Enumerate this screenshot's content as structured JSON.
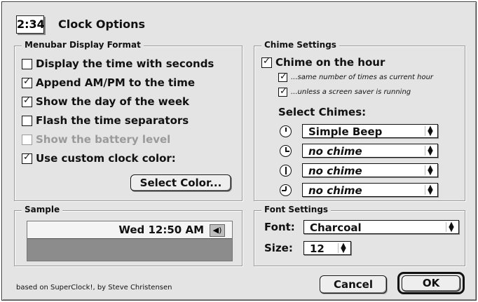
{
  "window": {
    "time_badge": "2:34",
    "title": "Clock Options"
  },
  "menubar_group": {
    "title": "Menubar Display Format",
    "options": [
      {
        "label": "Display the time with seconds",
        "checked": false,
        "enabled": true
      },
      {
        "label": "Append AM/PM to the time",
        "checked": true,
        "enabled": true
      },
      {
        "label": "Show the day of the week",
        "checked": true,
        "enabled": true
      },
      {
        "label": "Flash the time separators",
        "checked": false,
        "enabled": true
      },
      {
        "label": "Show the battery level",
        "checked": false,
        "enabled": false
      },
      {
        "label": "Use custom clock color:",
        "checked": true,
        "enabled": true
      }
    ],
    "select_color_button": "Select Color..."
  },
  "chime_group": {
    "title": "Chime Settings",
    "chime_on_hour": {
      "label": "Chime on the hour",
      "checked": true
    },
    "same_number": {
      "label": "...same number of times as current hour",
      "checked": true
    },
    "unless_saver": {
      "label": "...unless a screen saver is running",
      "checked": true
    },
    "select_chimes_label": "Select Chimes:",
    "chimes": [
      {
        "icon": "clock-hour-icon",
        "value": "Simple Beep"
      },
      {
        "icon": "clock-quarter-icon",
        "value": "no chime"
      },
      {
        "icon": "clock-half-icon",
        "value": "no chime"
      },
      {
        "icon": "clock-three-quarter-icon",
        "value": "no chime"
      }
    ]
  },
  "sample_group": {
    "title": "Sample",
    "preview_text": "Wed 12:50 AM",
    "preview_icon": "speaker-icon",
    "preview_color": "#8c8c8c"
  },
  "font_group": {
    "title": "Font Settings",
    "font_label": "Font:",
    "font_value": "Charcoal",
    "size_label": "Size:",
    "size_value": "12"
  },
  "footer": {
    "credit": "based on SuperClock!, by Steve Christensen",
    "cancel_button": "Cancel",
    "ok_button": "OK"
  }
}
